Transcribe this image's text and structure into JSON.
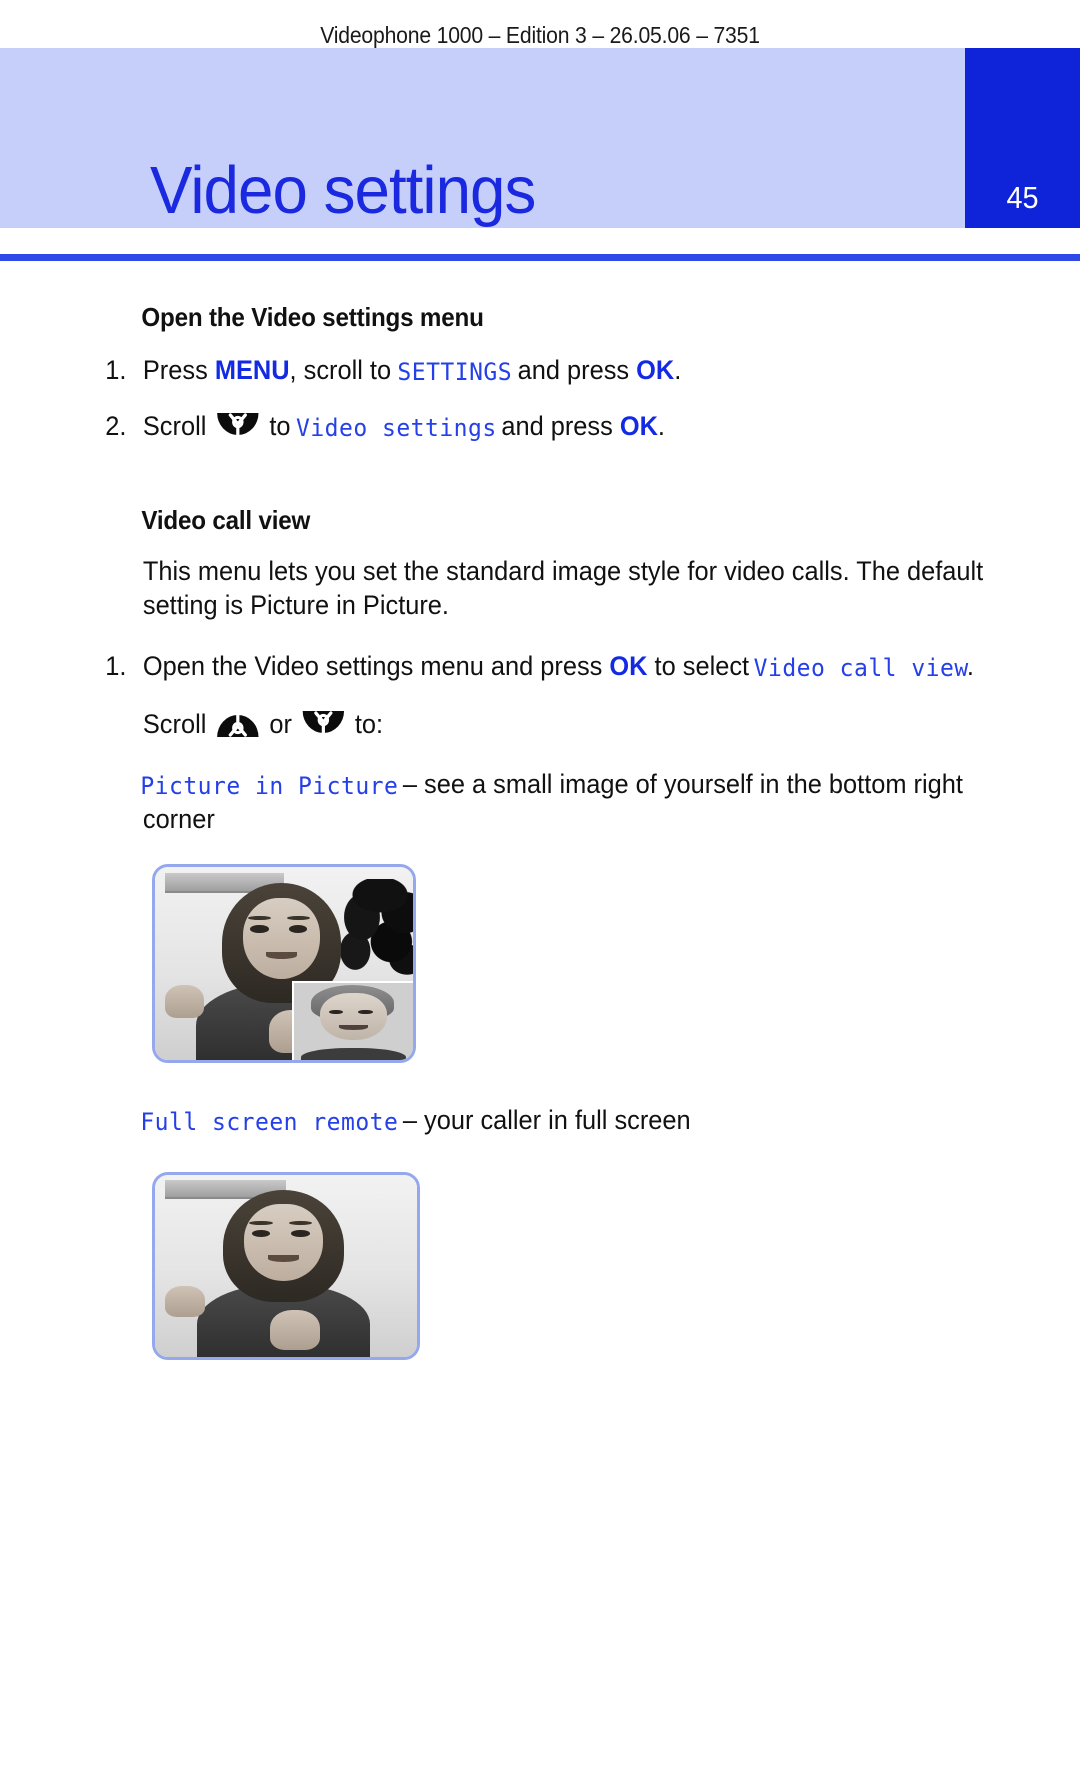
{
  "header": {
    "running_head": "Videophone 1000 – Edition 3 – 26.05.06 – 7351"
  },
  "title_band": {
    "chapter_title": "Video settings",
    "page_number": "45",
    "band_color": "#c6cefa",
    "tab_color": "#0f24d8",
    "title_color": "#1a28e0",
    "rule_color": "#2f48e8"
  },
  "sections": [
    {
      "heading": "Open the Video settings menu",
      "steps": [
        {
          "number": "1.",
          "seg_a": "Press ",
          "ui_a": "MENU",
          "seg_b": ", scroll to ",
          "lcd_a": "SETTINGS",
          "seg_c": " and press ",
          "ui_b": "OK",
          "seg_d": "."
        },
        {
          "number": "2.",
          "seg_a": "Scroll ",
          "icon": "scroll-down-key-icon",
          "seg_b": " to ",
          "lcd_a": "Video settings",
          "seg_c": " and press ",
          "ui_b": "OK",
          "seg_d": "."
        }
      ]
    },
    {
      "heading": "Video call view",
      "intro": "This menu lets you set the standard image style for video calls. The default setting is Picture in Picture.",
      "steps": [
        {
          "number": "1.",
          "seg_a": "Open the Video settings menu and press ",
          "ui_a": "OK",
          "seg_b": " to select ",
          "lcd_a": "Video call view",
          "seg_c": "."
        }
      ],
      "scroll_line": {
        "seg_a": "Scroll ",
        "icon_up": "scroll-up-key-icon",
        "seg_b": " or ",
        "icon_down": "scroll-down-key-icon",
        "seg_c": " to:"
      },
      "options": [
        {
          "lcd_label": "Picture in Picture",
          "description": " – see a small image of yourself in the bottom right corner",
          "image_alt": "picture-in-picture-screen-illustration"
        },
        {
          "lcd_label": "Full screen remote",
          "description": " – your caller in full screen",
          "image_alt": "full-screen-remote-illustration"
        }
      ]
    }
  ],
  "colors": {
    "ui_blue": "#132ae5",
    "lcd_blue": "#2540e8",
    "text_black": "#111111",
    "screen_border": "#95a8ee"
  }
}
